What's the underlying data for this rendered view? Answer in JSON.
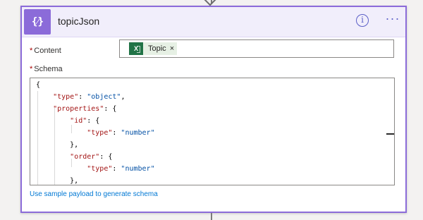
{
  "card": {
    "title": "topicJson",
    "icon": "json-curly-braces-icon",
    "icon_text": "{⁄}"
  },
  "fields": {
    "content": {
      "label": "Content",
      "required_marker": "*",
      "token": {
        "label": "Topic",
        "icon": "excel-icon",
        "remove": "×"
      }
    },
    "schema": {
      "label": "Schema",
      "required_marker": "*",
      "lines": [
        "{",
        "    \"type\": \"object\",",
        "    \"properties\": {",
        "        \"id\": {",
        "            \"type\": \"number\"",
        "        },",
        "        \"order\": {",
        "            \"type\": \"number\"",
        "        },",
        "        \"..........\": {"
      ]
    }
  },
  "actions": {
    "sample_payload_link": "Use sample payload to generate schema",
    "info_icon": "i",
    "more_icon": "···"
  },
  "colors": {
    "accent": "#8b6bd9",
    "header_bg": "#f1eefb",
    "link": "#0078d4",
    "token_bg": "#e6f0e4",
    "excel": "#217346"
  }
}
